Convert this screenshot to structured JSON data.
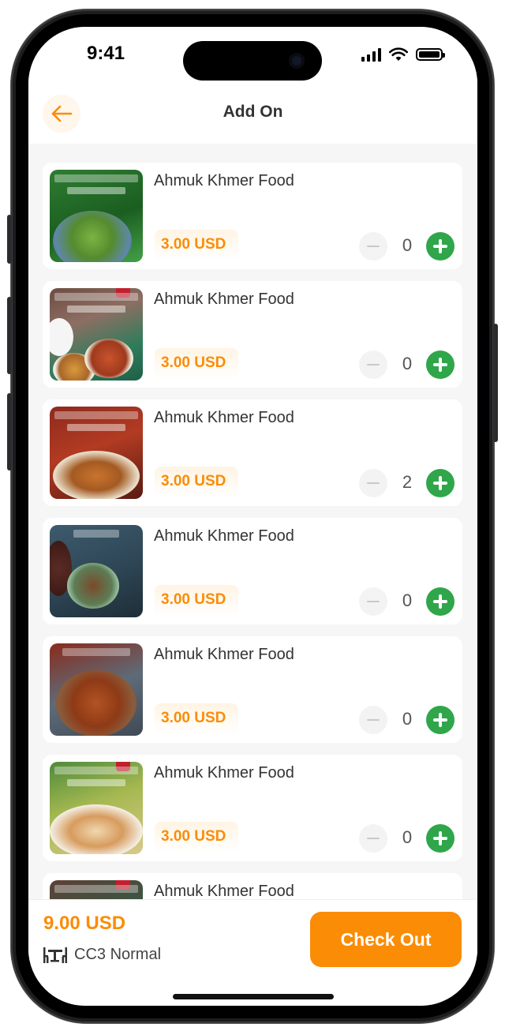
{
  "status_bar": {
    "time": "9:41"
  },
  "header": {
    "title": "Add On",
    "back_icon": "arrow-left-icon",
    "accent_color": "#fb8c06"
  },
  "items": [
    {
      "name": "Ahmuk Khmer Food",
      "price": "3.00 USD",
      "quantity": "0"
    },
    {
      "name": "Ahmuk Khmer Food",
      "price": "3.00 USD",
      "quantity": "0"
    },
    {
      "name": "Ahmuk Khmer Food",
      "price": "3.00 USD",
      "quantity": "2"
    },
    {
      "name": "Ahmuk Khmer Food",
      "price": "3.00 USD",
      "quantity": "0"
    },
    {
      "name": "Ahmuk Khmer Food",
      "price": "3.00 USD",
      "quantity": "0"
    },
    {
      "name": "Ahmuk Khmer Food",
      "price": "3.00 USD",
      "quantity": "0"
    },
    {
      "name": "Ahmuk Khmer Food"
    }
  ],
  "footer": {
    "total": "9.00 USD",
    "table_icon": "dining-table-icon",
    "table_label": "CC3 Normal",
    "checkout_label": "Check Out"
  },
  "colors": {
    "accent": "#fb8c06",
    "plus_button": "#2fa64a"
  }
}
